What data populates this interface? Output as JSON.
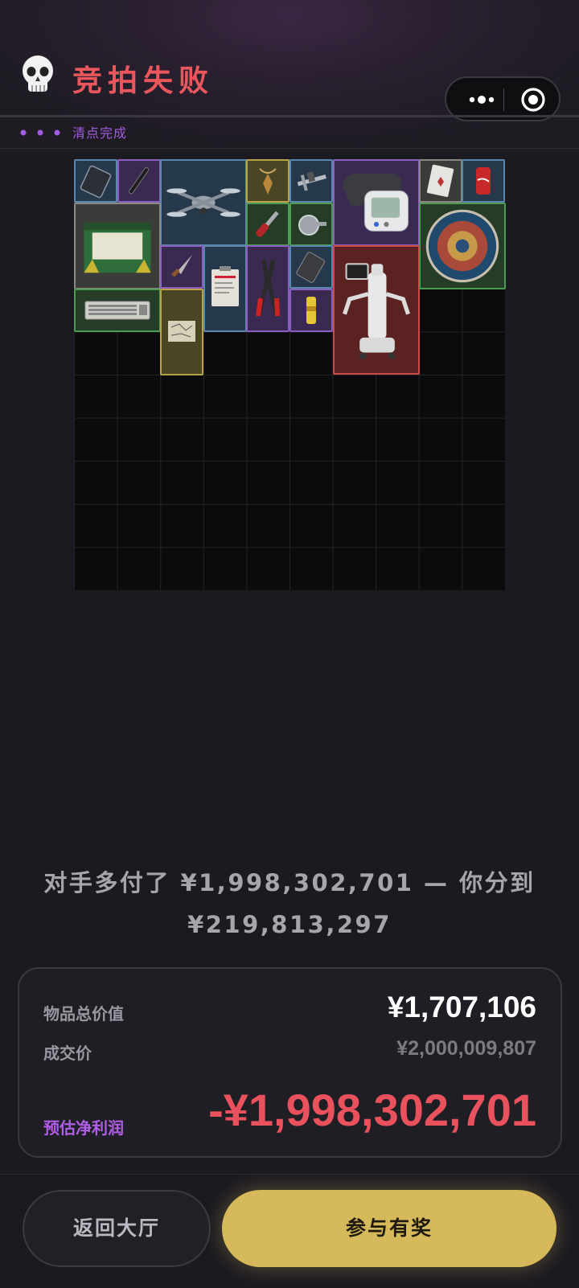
{
  "header": {
    "icon": "skull-icon",
    "title": "竞拍失败",
    "status_text": "清点完成",
    "accent_color": "#e9575d",
    "status_color": "#a25de2"
  },
  "capsule": {
    "more_icon": "more-dots-icon",
    "target_icon": "target-icon"
  },
  "summary": {
    "line1": "对手多付了 ¥1,998,302,701 — 你分到",
    "line2": "¥219,813,297"
  },
  "card": {
    "total_label": "物品总价值",
    "total_value": "¥1,707,106",
    "deal_label": "成交价",
    "deal_value": "¥2,000,009,807",
    "profit_label": "预估净利润",
    "profit_value": "-¥1,998,302,701"
  },
  "buttons": {
    "back": "返回大厅",
    "join": "参与有奖",
    "join_color": "#d5b95a"
  },
  "inventory_items": [
    {
      "name": "hard-drive",
      "rarity": "blue"
    },
    {
      "name": "pen",
      "rarity": "purple"
    },
    {
      "name": "drone",
      "rarity": "blue"
    },
    {
      "name": "pendant",
      "rarity": "yellow"
    },
    {
      "name": "caliper",
      "rarity": "blue"
    },
    {
      "name": "blood-pressure-monitor",
      "rarity": "purple"
    },
    {
      "name": "playing-card",
      "rarity": "gray"
    },
    {
      "name": "cola-can",
      "rarity": "blue"
    },
    {
      "name": "candle-box",
      "rarity": "gray"
    },
    {
      "name": "screwdriver",
      "rarity": "green"
    },
    {
      "name": "shower-head",
      "rarity": "green"
    },
    {
      "name": "decorative-plate",
      "rarity": "green"
    },
    {
      "name": "dagger",
      "rarity": "purple"
    },
    {
      "name": "clipboard",
      "rarity": "blue"
    },
    {
      "name": "bolt-cutter",
      "rarity": "purple"
    },
    {
      "name": "power-bank",
      "rarity": "blue"
    },
    {
      "name": "robot",
      "rarity": "red"
    },
    {
      "name": "keyboard",
      "rarity": "green"
    },
    {
      "name": "map-document",
      "rarity": "yellow"
    },
    {
      "name": "energy-drink",
      "rarity": "purple"
    }
  ]
}
